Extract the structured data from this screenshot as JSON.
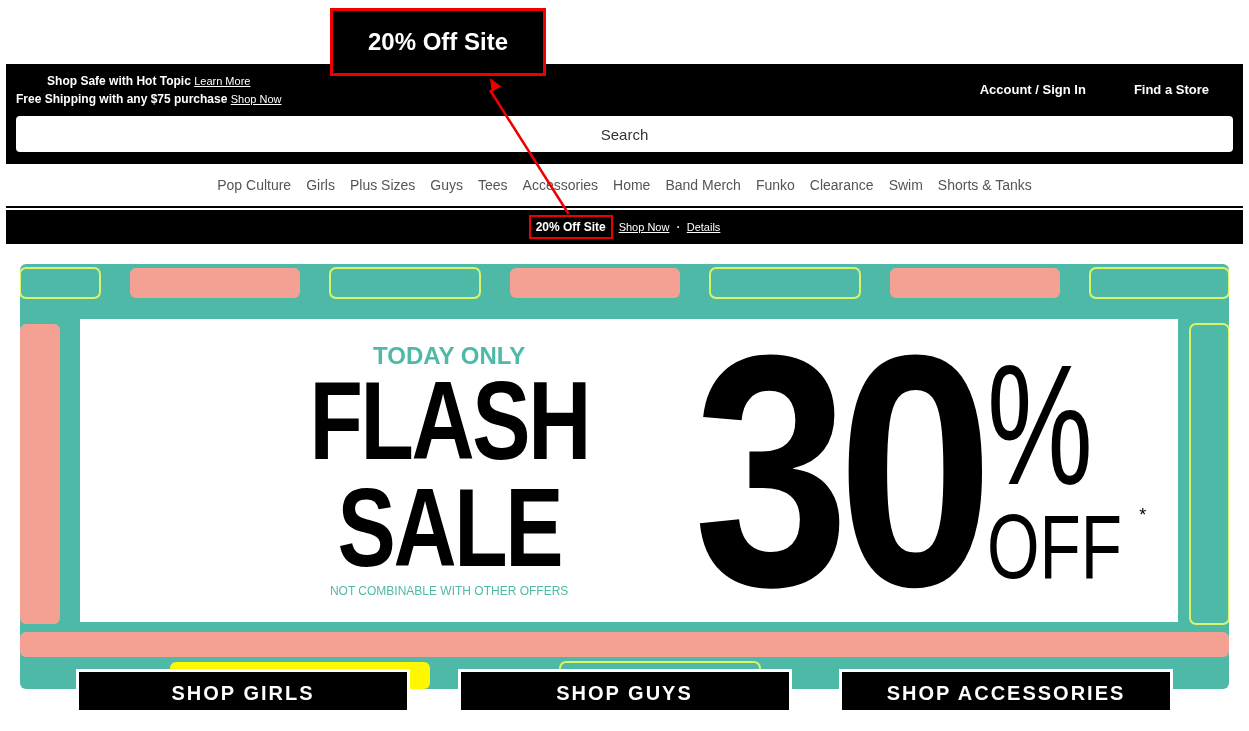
{
  "annotation": {
    "callout": "20% Off Site"
  },
  "header": {
    "lines": [
      {
        "text": "Shop Safe with Hot Topic",
        "link": "Learn More"
      },
      {
        "text": "Free Shipping with any $75 purchase",
        "link": "Shop Now"
      }
    ],
    "links": [
      "Account / Sign In",
      "Find a Store"
    ],
    "search": {
      "placeholder": "Search"
    }
  },
  "nav": [
    "Pop Culture",
    "Girls",
    "Plus Sizes",
    "Guys",
    "Tees",
    "Accessories",
    "Home",
    "Band Merch",
    "Funko",
    "Clearance",
    "Swim",
    "Shorts & Tanks"
  ],
  "promo_bar": {
    "offer": "20% Off Site",
    "links": [
      "Shop Now",
      "Details"
    ],
    "separator": "·"
  },
  "banner": {
    "background": {
      "kind": "picture"
    },
    "eyebrow": "TODAY ONLY",
    "headline": [
      "FLASH",
      "SALE"
    ],
    "amount": "30",
    "percent": "%",
    "off": "OFF",
    "asterisk": "*",
    "fine_print": "NOT COMBINABLE WITH OTHER OFFERS",
    "buttons": [
      "SHOP GIRLS",
      "SHOP GUYS",
      "SHOP ACCESSORIES"
    ]
  }
}
